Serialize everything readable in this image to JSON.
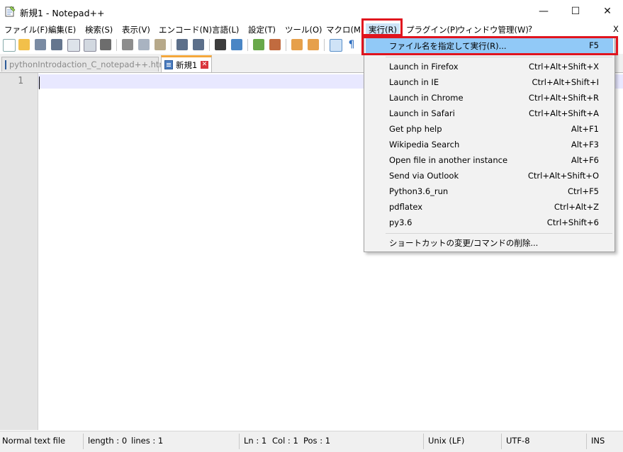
{
  "window": {
    "title": "新規1 - Notepad++",
    "minimize_glyph": "—",
    "maximize_glyph": "☐",
    "close_glyph": "✕",
    "app_icon": "notepad-icon"
  },
  "menubar": {
    "items": [
      {
        "label": "ファイル(F)"
      },
      {
        "label": "編集(E)"
      },
      {
        "label": "検索(S)"
      },
      {
        "label": "表示(V)"
      },
      {
        "label": "エンコード(N)"
      },
      {
        "label": "言語(L)"
      },
      {
        "label": "設定(T)"
      },
      {
        "label": "ツール(O)"
      },
      {
        "label": "マクロ(M)"
      },
      {
        "label": "実行(R)"
      },
      {
        "label": "プラグイン(P)"
      },
      {
        "label": "ウィンドウ管理(W)"
      },
      {
        "label": "?"
      }
    ],
    "close_doc": "X"
  },
  "tabs": [
    {
      "label": "pythonIntrodaction_C_notepad++.html",
      "close": "✕"
    },
    {
      "label": "新規1",
      "close": "✕"
    }
  ],
  "editor": {
    "line_number": "1"
  },
  "run_menu": {
    "items": [
      {
        "label": "ファイル名を指定して実行(R)...",
        "shortcut": "F5"
      },
      {
        "label": "Launch in Firefox",
        "shortcut": "Ctrl+Alt+Shift+X"
      },
      {
        "label": "Launch in IE",
        "shortcut": "Ctrl+Alt+Shift+I"
      },
      {
        "label": "Launch in Chrome",
        "shortcut": "Ctrl+Alt+Shift+R"
      },
      {
        "label": "Launch in Safari",
        "shortcut": "Ctrl+Alt+Shift+A"
      },
      {
        "label": "Get php help",
        "shortcut": "Alt+F1"
      },
      {
        "label": "Wikipedia Search",
        "shortcut": "Alt+F3"
      },
      {
        "label": "Open file in another instance",
        "shortcut": "Alt+F6"
      },
      {
        "label": "Send via Outlook",
        "shortcut": "Ctrl+Alt+Shift+O"
      },
      {
        "label": "Python3.6_run",
        "shortcut": "Ctrl+F5"
      },
      {
        "label": "pdflatex",
        "shortcut": "Ctrl+Alt+Z"
      },
      {
        "label": "py3.6",
        "shortcut": "Ctrl+Shift+6"
      },
      {
        "label": "ショートカットの変更/コマンドの削除...",
        "shortcut": ""
      }
    ]
  },
  "statusbar": {
    "file_type": "Normal text file",
    "length": "length : 0",
    "lines": "lines : 1",
    "ln": "Ln : 1",
    "col": "Col : 1",
    "pos": "Pos : 1",
    "eol": "Unix (LF)",
    "encoding": "UTF-8",
    "mode": "INS"
  },
  "colors": {
    "highlight_red": "#e0141e",
    "menu_hover": "#91c9f7",
    "current_line": "#e8e8ff",
    "active_tab_accent": "#f4a73b"
  }
}
